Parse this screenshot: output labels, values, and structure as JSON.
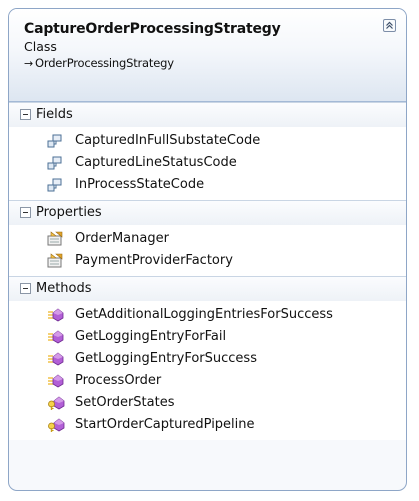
{
  "class": {
    "name": "CaptureOrderProcessingStrategy",
    "kind": "Class",
    "base_arrow": "→",
    "base": "OrderProcessingStrategy",
    "collapse_icon": "double-chevron-up-icon"
  },
  "sections": {
    "fields": {
      "title": "Fields",
      "items": [
        "CapturedInFullSubstateCode",
        "CapturedLineStatusCode",
        "InProcessStateCode"
      ]
    },
    "properties": {
      "title": "Properties",
      "items": [
        "OrderManager",
        "PaymentProviderFactory"
      ]
    },
    "methods": {
      "title": "Methods",
      "items": [
        "GetAdditionalLoggingEntriesForSuccess",
        "GetLoggingEntryForFail",
        "GetLoggingEntryForSuccess",
        "ProcessOrder",
        "SetOrderStates",
        "StartOrderCapturedPipeline"
      ]
    }
  },
  "colors": {
    "border": "#8ea6c7",
    "method_icon": "#a04bc4",
    "field_icon": "#4b6f95",
    "property_icon": "#c98a1c"
  }
}
